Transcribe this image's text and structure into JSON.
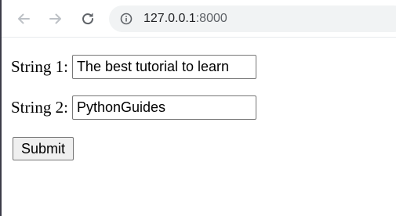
{
  "browser": {
    "address_host": "127.0.0.1",
    "address_port": ":8000",
    "back_icon": "arrow-left-icon",
    "forward_icon": "arrow-right-icon",
    "reload_icon": "reload-icon",
    "site_info_icon": "info-circle-icon"
  },
  "form": {
    "string1_label": "String 1:",
    "string1_value": "The best tutorial to learn",
    "string2_label": "String 2:",
    "string2_value": "PythonGuides",
    "submit_label": "Submit"
  },
  "colors": {
    "toolbar_background": "#ffffff",
    "omnibox_background": "#f1f3f4",
    "nav_icon_disabled": "#bdc1c6",
    "nav_icon_enabled": "#5f6368"
  }
}
